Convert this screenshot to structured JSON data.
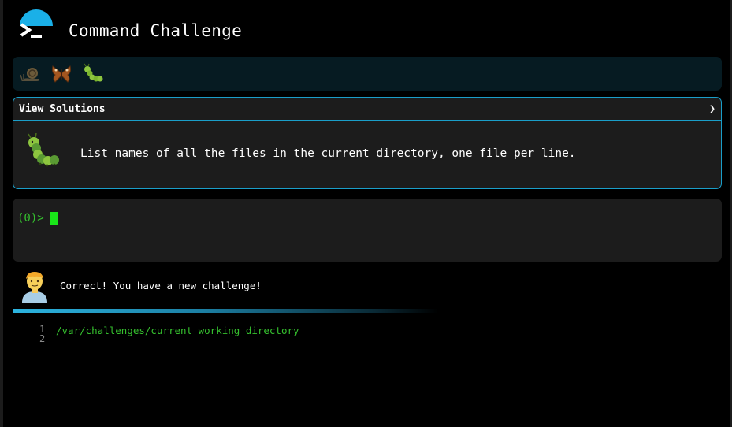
{
  "header": {
    "title": "Command Challenge",
    "logo_icon": "terminal-prompt-icon",
    "logo_color": "#1ab0e8"
  },
  "badges": {
    "items": [
      {
        "icon": "snail-icon"
      },
      {
        "icon": "butterfly-icon"
      },
      {
        "icon": "caterpillar-icon"
      }
    ],
    "background": "#061b22"
  },
  "challenge": {
    "header_label": "View Solutions",
    "chevron": "❯",
    "icon": "caterpillar-icon",
    "description": "List names of all the files in the current directory, one file per line.",
    "border_color": "#1a9ec9"
  },
  "terminal": {
    "prompt": "(0)>",
    "input_value": "",
    "prompt_color": "#35c02e",
    "cursor_color": "#19e619"
  },
  "message": {
    "avatar": "person-avatar-icon",
    "text": "Correct! You have a new challenge!"
  },
  "editor": {
    "line_numbers": [
      "1",
      "2"
    ],
    "lines": [
      "/var/challenges/current_working_directory",
      ""
    ],
    "text_color": "#35c02e"
  }
}
